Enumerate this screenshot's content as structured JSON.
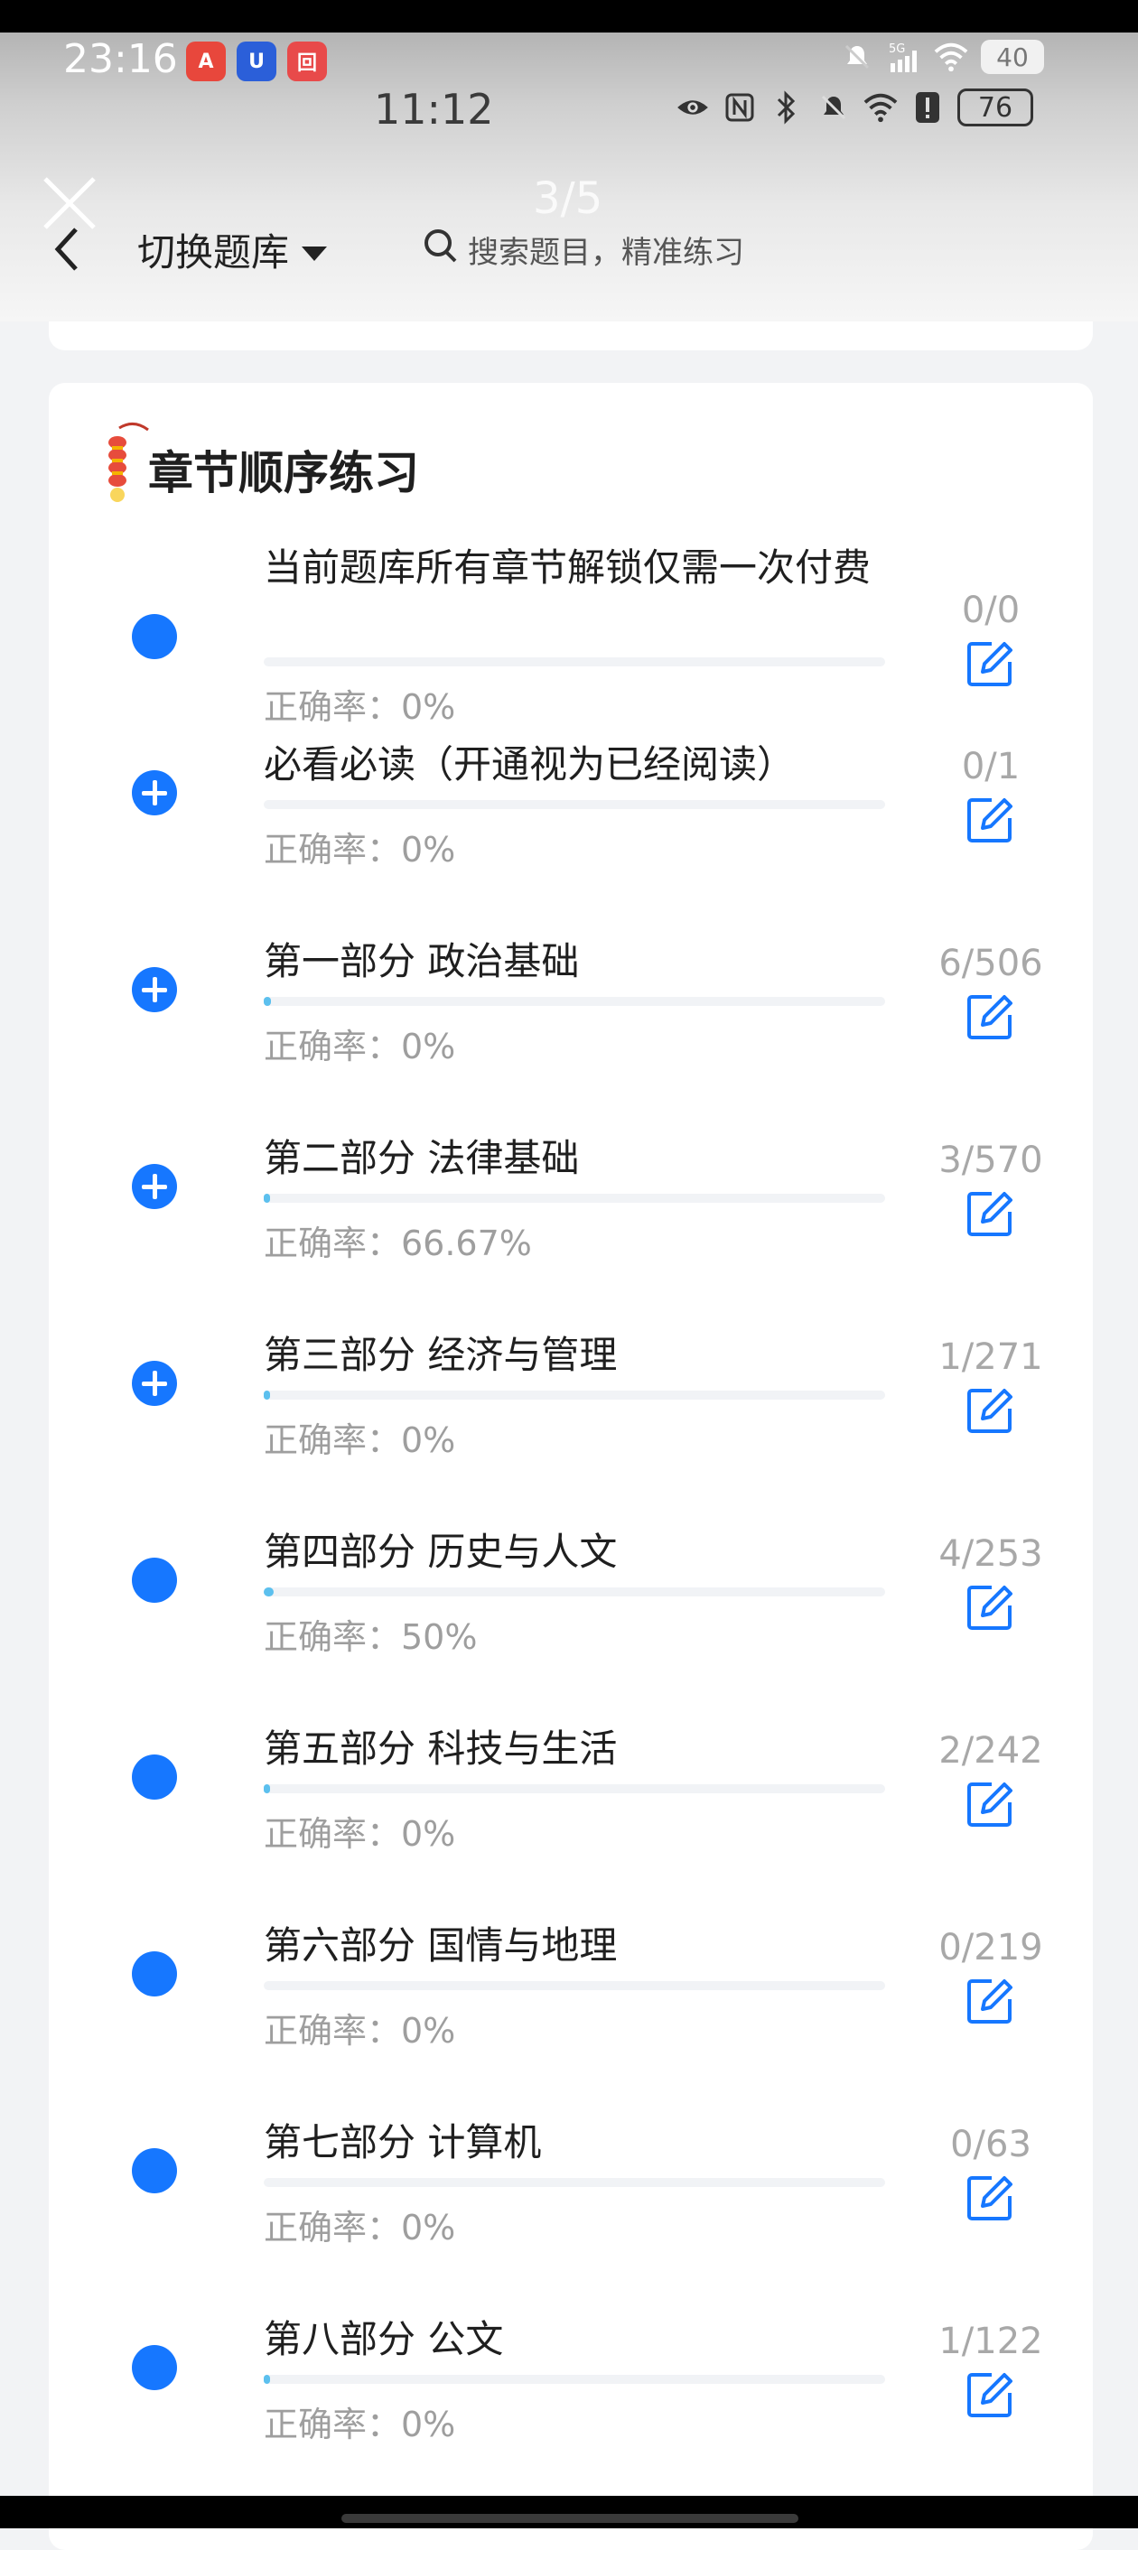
{
  "status_bar_outer": {
    "time": "23:16",
    "app_icons": [
      {
        "name": "app-icon-a",
        "glyph": "A",
        "color": "#e8473c"
      },
      {
        "name": "app-icon-u",
        "glyph": "U",
        "color": "#2b5fd9"
      },
      {
        "name": "app-icon-pattern",
        "glyph": "回",
        "color": "#e84a4a"
      }
    ],
    "network": "5G",
    "battery": "40"
  },
  "status_bar_inner": {
    "time": "11:12",
    "battery": "76"
  },
  "page_indicator": "3/5",
  "header": {
    "switch_label": "切换题库",
    "search_placeholder": "搜索题目，精准练习"
  },
  "section_title": "章节顺序练习",
  "colors": {
    "accent": "#1677ff",
    "progress": "#5cc0ee",
    "muted": "#9e9e9e"
  },
  "chapters": [
    {
      "title": "当前题库所有章节解锁仅需一次付费",
      "count": "0/0",
      "accuracy": "正确率：0%",
      "progress": 0,
      "expandable": false
    },
    {
      "title": "必看必读（开通视为已经阅读）",
      "count": "0/1",
      "accuracy": "正确率：0%",
      "progress": 0,
      "expandable": true
    },
    {
      "title": "第一部分 政治基础",
      "count": "6/506",
      "accuracy": "正确率：0%",
      "progress": 0.0119,
      "expandable": true
    },
    {
      "title": "第二部分 法律基础",
      "count": "3/570",
      "accuracy": "正确率：66.67%",
      "progress": 0.0053,
      "expandable": true
    },
    {
      "title": "第三部分 经济与管理",
      "count": "1/271",
      "accuracy": "正确率：0%",
      "progress": 0.0037,
      "expandable": true
    },
    {
      "title": "第四部分 历史与人文",
      "count": "4/253",
      "accuracy": "正确率：50%",
      "progress": 0.0158,
      "expandable": false
    },
    {
      "title": "第五部分 科技与生活",
      "count": "2/242",
      "accuracy": "正确率：0%",
      "progress": 0.0083,
      "expandable": false
    },
    {
      "title": "第六部分 国情与地理",
      "count": "0/219",
      "accuracy": "正确率：0%",
      "progress": 0,
      "expandable": false
    },
    {
      "title": "第七部分 计算机",
      "count": "0/63",
      "accuracy": "正确率：0%",
      "progress": 0,
      "expandable": false
    },
    {
      "title": "第八部分 公文",
      "count": "1/122",
      "accuracy": "正确率：0%",
      "progress": 0.0082,
      "expandable": false
    }
  ]
}
